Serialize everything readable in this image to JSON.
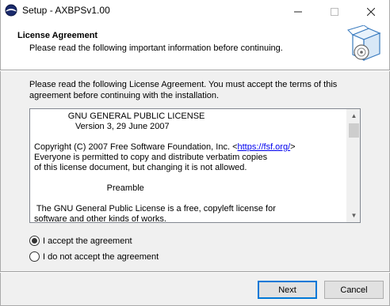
{
  "window": {
    "title": "Setup - AXBPSv1.00",
    "minimize_glyph": "—",
    "maximize_glyph": "☐",
    "close_glyph": "✕"
  },
  "header": {
    "title": "License Agreement",
    "subtitle": "Please read the following important information before continuing.",
    "icon": "installer-box-disc-icon"
  },
  "intro": "Please read the following License Agreement. You must accept the terms of this agreement before continuing with the installation.",
  "license": {
    "line1": "              GNU GENERAL PUBLIC LICENSE",
    "line2": "                 Version 3, 29 June 2007",
    "copyright_pre": "Copyright (C) 2007 Free Software Foundation, Inc. <",
    "copyright_link": "https://fsf.org/",
    "copyright_post": ">",
    "line4": "Everyone is permitted to copy and distribute verbatim copies",
    "line5": "of this license document, but changing it is not allowed.",
    "line6": "                              Preamble",
    "line7": " The GNU General Public License is a free, copyleft license for",
    "line8": "software and other kinds of works."
  },
  "options": {
    "accept_label": "I accept the agreement",
    "decline_label": "I do not accept the agreement",
    "selected": "accept"
  },
  "buttons": {
    "next": "Next",
    "cancel": "Cancel"
  }
}
